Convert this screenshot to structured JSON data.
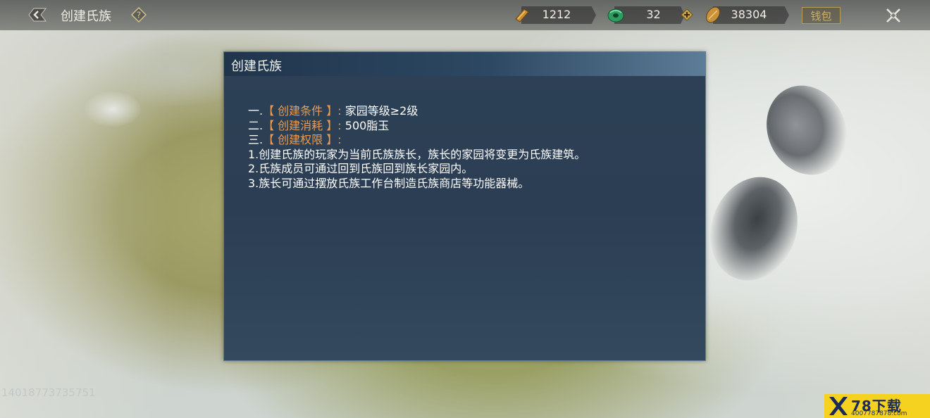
{
  "header": {
    "title": "创建氏族",
    "back_icon": "chevron-left-icon",
    "help_icon": "question-diamond-icon",
    "resources": [
      {
        "name": "resource-scroll",
        "icon": "scroll-icon",
        "value": "1212"
      },
      {
        "name": "resource-jade",
        "icon": "jade-icon",
        "value": "32"
      },
      {
        "name": "resource-gold",
        "icon": "gold-leaf-icon",
        "value": "38304"
      }
    ],
    "wallet_label": "钱包",
    "close_icon": "close-icon"
  },
  "dialog": {
    "title": "创建氏族",
    "lines": [
      {
        "prefix": "一.",
        "tag": "【 创建条件 】:",
        "text": " 家园等级≥2级"
      },
      {
        "prefix": "二.",
        "tag": "【 创建消耗 】:",
        "text": " 500脂玉"
      },
      {
        "prefix": "三.",
        "tag": "【 创建权限 】:",
        "text": ""
      },
      {
        "prefix": "",
        "tag": "",
        "text": "1.创建氏族的玩家为当前氏族族长，族长的家园将变更为氏族建筑。"
      },
      {
        "prefix": "",
        "tag": "",
        "text": "2.氏族成员可通过回到氏族回到族长家园内。"
      },
      {
        "prefix": "",
        "tag": "",
        "text": "3.族长可通过摆放氏族工作台制造氏族商店等功能器械。"
      }
    ]
  },
  "player_id": "14018773735751",
  "watermark": {
    "title": "78下载",
    "phone": "4007787878.com"
  },
  "colors": {
    "highlight": "#e79b57",
    "dialog_bg": "#2d4156",
    "wallet_gold": "#c9b16b"
  }
}
